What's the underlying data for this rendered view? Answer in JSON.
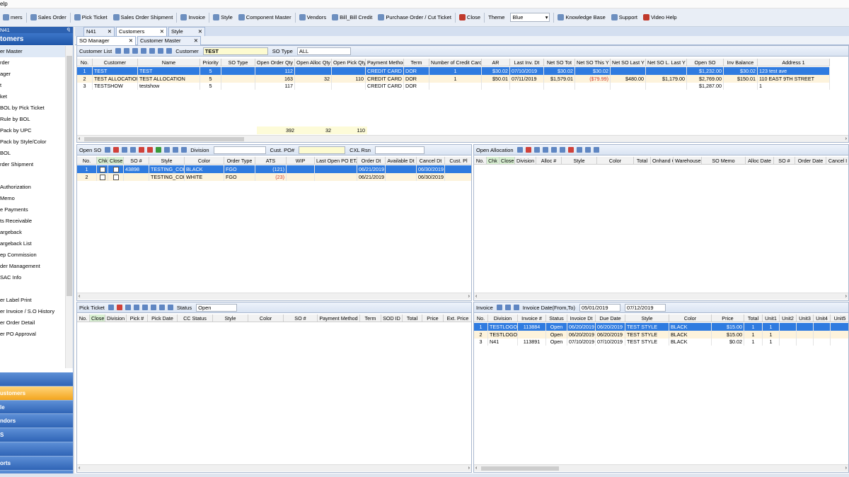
{
  "menu": {
    "help": "elp"
  },
  "toolbar": {
    "items": [
      "mers",
      "Sales Order",
      "Pick Ticket",
      "Sales Order Shipment",
      "Invoice",
      "Style",
      "Component Master",
      "Vendors",
      "Bill_Bill Credit",
      "Purchase Order / Cut Ticket",
      "Close"
    ],
    "theme_label": "Theme",
    "theme_value": "Blue",
    "right_items": [
      "Knowledge Base",
      "Support",
      "Video Help"
    ]
  },
  "sidebar": {
    "header": "N41",
    "pin": "ꟼ",
    "title": "tomers",
    "items": [
      "er Master",
      "rder",
      "ager",
      "t",
      "ket",
      "BOL by Pick Ticket",
      "Rule by BOL",
      "Pack by UPC",
      "Pack by Style/Color",
      "BOL",
      "rder Shipment",
      "",
      "Authorization",
      "Memo",
      "e Payments",
      "ts Receivable",
      "argeback",
      "argeback List",
      "ep Commission",
      "der Management",
      "SAC Info",
      "",
      "er Label Print",
      "er Invoice / S.O History",
      "er Order Detail",
      "er PO Approval"
    ],
    "nav": [
      "",
      "ustomers",
      "le",
      "ndors",
      "S",
      "",
      "orts",
      "mpany Setup"
    ],
    "nav_bottom": "»"
  },
  "tabs_top": [
    {
      "label": "N41"
    },
    {
      "label": "Customers"
    },
    {
      "label": "Style"
    }
  ],
  "tabs_sub": [
    {
      "label": "SO Manager"
    },
    {
      "label": "Customer Master"
    }
  ],
  "customer_panel": {
    "tool_label": "Customer List",
    "customer_label": "Customer",
    "customer_value": "TEST",
    "so_type_label": "SO Type",
    "so_type_value": "ALL",
    "columns": [
      "No.",
      "Customer",
      "Name",
      "Priority",
      "SO Type",
      "Open Order Qty",
      "Open Alloc Qty",
      "Open Pick Qty",
      "Payment Method",
      "Term",
      "Number of Credit Card",
      "AR",
      "Last Inv. Dt",
      "Net SO Tot",
      "Net SO This Y",
      "Net SO Last Y",
      "Net SO L. Last Y",
      "Open SO",
      "Inv Balance",
      "Address 1"
    ],
    "rows": [
      [
        "1",
        "TEST",
        "TEST",
        "5",
        "",
        "112",
        "",
        "",
        "CREDIT CARD",
        "DOR",
        "1",
        "$30.02",
        "07/10/2019",
        "$30.02",
        "$30.02",
        "",
        "",
        "$1,232.00",
        "$30.02",
        "123 test ave"
      ],
      [
        "2",
        "TEST ALLOCATION",
        "TEST ALLOCATION",
        "5",
        "",
        "163",
        "32",
        "110",
        "CREDIT CARD",
        "DOR",
        "1",
        "$50.01",
        "07/11/2019",
        "$1,579.01",
        "($79.99)",
        "$480.00",
        "$1,179.00",
        "$2,769.00",
        "$150.01",
        "110 EAST 9TH STREET"
      ],
      [
        "3",
        "TESTSHOW",
        "testshow",
        "5",
        "",
        "117",
        "",
        "",
        "CREDIT CARD",
        "DOR",
        "",
        "",
        "",
        "",
        "",
        "",
        "",
        "$1,287.00",
        "",
        "1"
      ]
    ],
    "totals": [
      "392",
      "32",
      "110"
    ]
  },
  "open_so_panel": {
    "tool_label": "Open SO",
    "division_label": "Division",
    "cust_po_label": "Cust. PO#",
    "cxl_label": "CXL Rsn",
    "columns": [
      "No.",
      "Chk",
      "Close",
      "SO #",
      "Style",
      "Color",
      "Order Type",
      "ATS",
      "WIP",
      "Last Open PO ETA",
      "Order Dt",
      "Available Dt",
      "Cancel Dt",
      "Cust. Pl"
    ],
    "rows": [
      [
        "1",
        "",
        "",
        "43898",
        "TESTING_COLO",
        "BLACK",
        "FGO",
        "(121)",
        "",
        "",
        "06/21/2019",
        "",
        "06/30/2019",
        ""
      ],
      [
        "2",
        "",
        "",
        "",
        "TESTING_COLO",
        "WHITE",
        "FGO",
        "(23)",
        "",
        "",
        "06/21/2019",
        "",
        "06/30/2019",
        ""
      ]
    ]
  },
  "open_alloc_panel": {
    "tool_label": "Open Allocation",
    "columns": [
      "No.",
      "Chk",
      "Close",
      "Division",
      "Alloc #",
      "Style",
      "Color",
      "Total",
      "Onhand Q",
      "Warehouse",
      "SO Memo",
      "Alloc Date",
      "SO #",
      "Order Date",
      "Cancel I"
    ]
  },
  "pick_panel": {
    "tool_label": "Pick Ticket",
    "status_label": "Status",
    "status_value": "Open",
    "columns": [
      "No.",
      "Close",
      "Division",
      "Pick #",
      "Pick Date",
      "CC Status",
      "Style",
      "Color",
      "SO #",
      "Payment Method",
      "Term",
      "SOD ID",
      "Total",
      "Price",
      "Ext. Price"
    ]
  },
  "invoice_panel": {
    "tool_label": "Invoice",
    "date_label": "Invoice Date(From,To)",
    "date_from": "05/01/2019",
    "date_to": "07/12/2019",
    "columns": [
      "No.",
      "Division",
      "Invoice #",
      "Status",
      "Invoice Dt",
      "Due Date",
      "Style",
      "Color",
      "Price",
      "Total",
      "Unit1",
      "Unit2",
      "Unit3",
      "Unit4",
      "Unit5"
    ],
    "rows": [
      [
        "1",
        "TESTLOGO",
        "113884",
        "Open",
        "06/20/2019",
        "06/20/2019",
        "TEST STYLE",
        "BLACK",
        "$15.00",
        "1",
        "1",
        "",
        "",
        "",
        ""
      ],
      [
        "2",
        "TESTLOGO",
        "",
        "Open",
        "06/20/2019",
        "06/20/2019",
        "TEST STYLE",
        "BLACK",
        "$15.00",
        "1",
        "1",
        "",
        "",
        "",
        ""
      ],
      [
        "3",
        "N41",
        "113891",
        "Open",
        "07/10/2019",
        "07/10/2019",
        "TEST STYLE",
        "BLACK",
        "$0.02",
        "1",
        "1",
        "",
        "",
        "",
        ""
      ]
    ]
  }
}
